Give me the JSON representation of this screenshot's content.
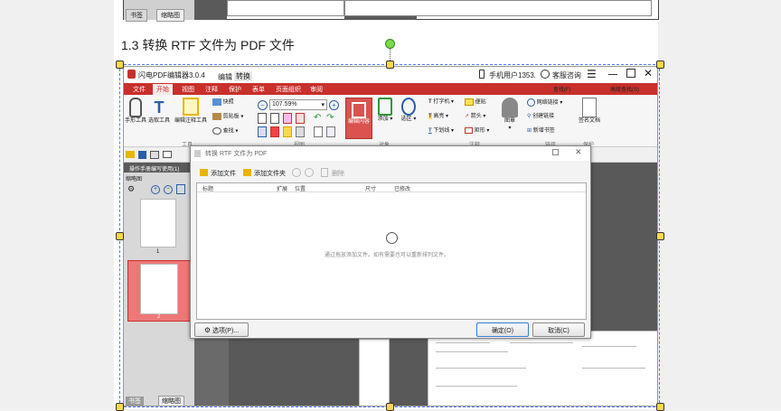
{
  "doc": {
    "heading": "1.3 转换 RTF 文件为 PDF 文件",
    "top_tabs": [
      "书签",
      "缩略图"
    ]
  },
  "app": {
    "title": "闪电PDF编辑器3.0.4",
    "menu": [
      "编辑",
      "转换"
    ],
    "user": "手机用户1353.",
    "support": "客服咨询",
    "ribbon_tabs": [
      "文件",
      "开始",
      "视图",
      "注释",
      "保护",
      "表单",
      "页面组织",
      "审阅"
    ],
    "find": "查找(F)",
    "advanced_find": "高级查找(S)",
    "tools": {
      "hand": "手形工具",
      "select": "选取工具",
      "annot_select": "编辑注释工具",
      "snapshot": "快照",
      "clipboard": "剪贴板",
      "find_small": "查找",
      "zoom": "107.59%",
      "edit_content": "编辑内容",
      "add": "添加",
      "select_tool": "选区",
      "typewriter": "打字机",
      "note": "便贴",
      "highlight": "高亮",
      "arrow": "箭头",
      "underline": "下划线",
      "rect": "矩形",
      "stamp": "图章",
      "web_link": "网络链接",
      "create_link": "创建链接",
      "new_bookmark": "新增书签",
      "sign_doc": "签名文档"
    },
    "groups": [
      "工具",
      "视图",
      "对象",
      "注释",
      "链接",
      "保护"
    ],
    "panel_title": "操作手册编写使用(1)",
    "thumbnails_label": "缩略图",
    "page_numbers": [
      "1",
      "2"
    ],
    "bottom_tabs": [
      "书签",
      "缩略图"
    ]
  },
  "dialog": {
    "title": "转换 RTF 文件为 PDF",
    "add_file": "添加文件",
    "add_folder": "添加文件夹",
    "delete": "删除",
    "columns": [
      "标题",
      "扩展",
      "位置",
      "尺寸",
      "已修改"
    ],
    "empty_hint": "通过拖放添加文件。如有需要也可以重新排列文件。",
    "options": "选项(P)...",
    "ok": "确定(O)",
    "cancel": "取消(C)"
  },
  "colors": {
    "ribbon_red": "#c8302b",
    "selection_handle": "#ffd84a",
    "rotation_handle": "#7bd94a"
  }
}
